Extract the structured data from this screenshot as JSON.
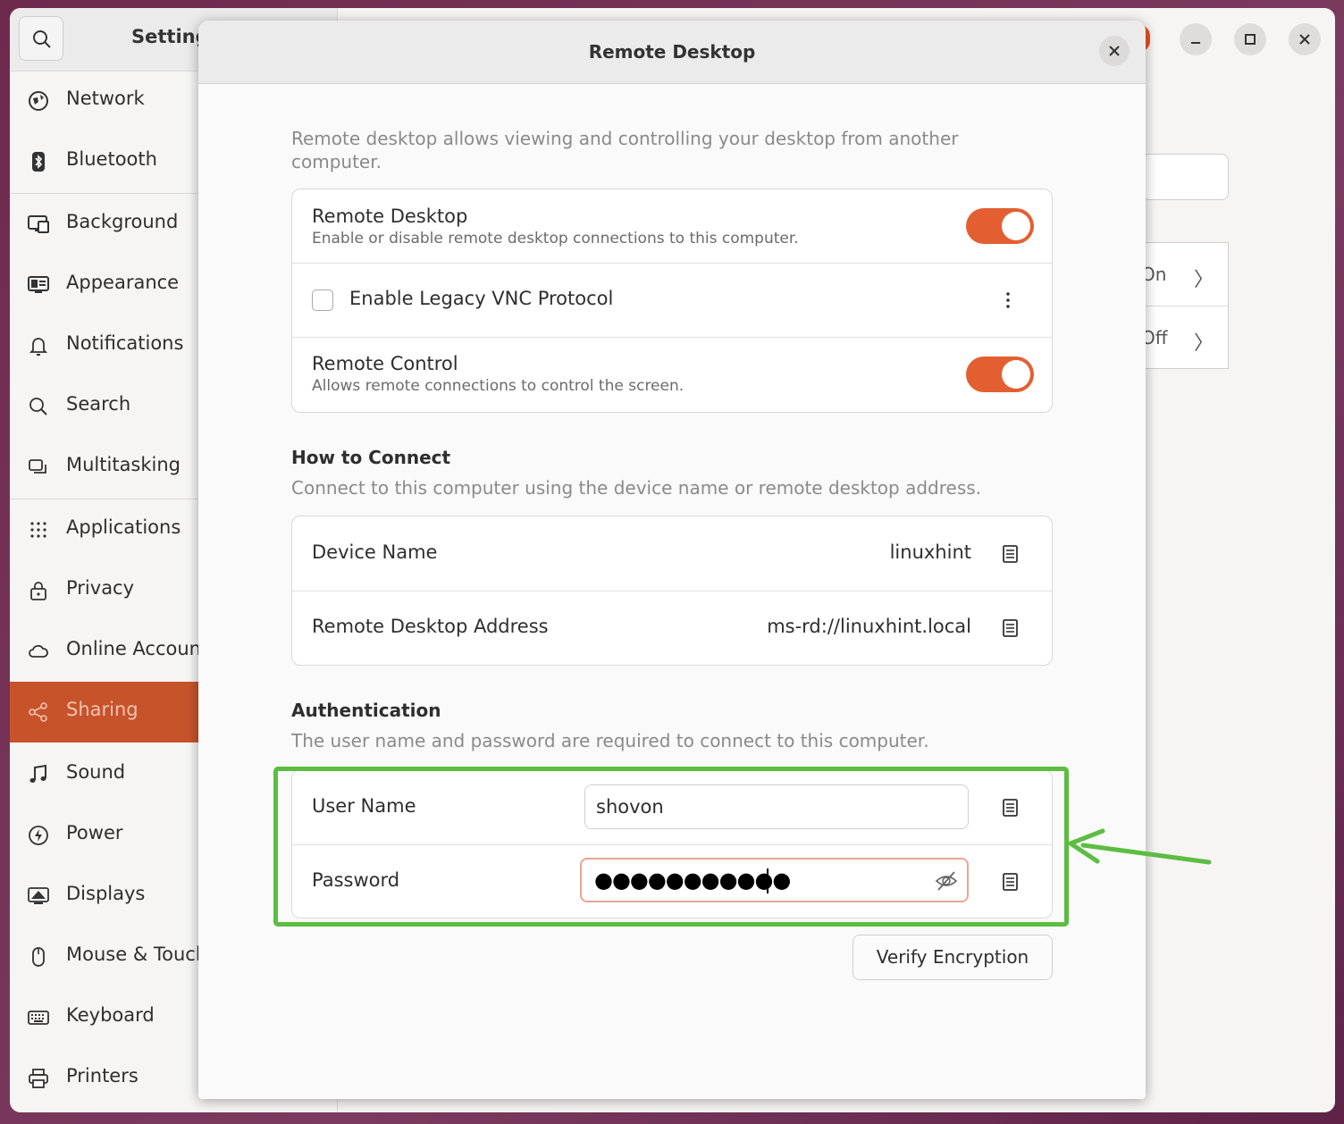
{
  "app": {
    "title": "Setting",
    "accent_color": "#e95420"
  },
  "sidebar": {
    "items": [
      {
        "label": "Network",
        "icon": "network-icon"
      },
      {
        "label": "Bluetooth",
        "icon": "bluetooth-icon"
      },
      {
        "label": "Background",
        "icon": "background-icon"
      },
      {
        "label": "Appearance",
        "icon": "appearance-icon"
      },
      {
        "label": "Notifications",
        "icon": "bell-icon"
      },
      {
        "label": "Search",
        "icon": "search-icon"
      },
      {
        "label": "Multitasking",
        "icon": "multitasking-icon"
      },
      {
        "label": "Applications",
        "icon": "apps-grid-icon"
      },
      {
        "label": "Privacy",
        "icon": "lock-icon"
      },
      {
        "label": "Online Account",
        "icon": "cloud-icon"
      },
      {
        "label": "Sharing",
        "icon": "share-icon",
        "active": true
      },
      {
        "label": "Sound",
        "icon": "music-note-icon"
      },
      {
        "label": "Power",
        "icon": "power-icon"
      },
      {
        "label": "Displays",
        "icon": "display-icon"
      },
      {
        "label": "Mouse & Touch",
        "icon": "mouse-icon"
      },
      {
        "label": "Keyboard",
        "icon": "keyboard-icon"
      },
      {
        "label": "Printers",
        "icon": "printer-icon"
      }
    ]
  },
  "background_panel": {
    "rows": [
      {
        "value": "On"
      },
      {
        "value": "Off"
      }
    ]
  },
  "dialog": {
    "title": "Remote Desktop",
    "intro": "Remote desktop allows viewing and controlling your desktop from another computer.",
    "settings": {
      "remote_desktop": {
        "title": "Remote Desktop",
        "subtitle": "Enable or disable remote desktop connections to this computer.",
        "enabled": true
      },
      "legacy_vnc": {
        "label": "Enable Legacy VNC Protocol",
        "checked": false
      },
      "remote_control": {
        "title": "Remote Control",
        "subtitle": "Allows remote connections to control the screen.",
        "enabled": true
      }
    },
    "how_to_connect": {
      "heading": "How to Connect",
      "description": "Connect to this computer using the device name or remote desktop address.",
      "device_name_label": "Device Name",
      "device_name_value": "linuxhint",
      "address_label": "Remote Desktop Address",
      "address_value": "ms-rd://linuxhint.local"
    },
    "authentication": {
      "heading": "Authentication",
      "description": "The user name and password are required to connect to this computer.",
      "username_label": "User Name",
      "username_value": "shovon",
      "password_label": "Password",
      "password_masked": "●●●●●●●●●●●"
    },
    "verify_button": "Verify Encryption"
  },
  "annotation": {
    "highlight_color": "#5cbd42"
  }
}
